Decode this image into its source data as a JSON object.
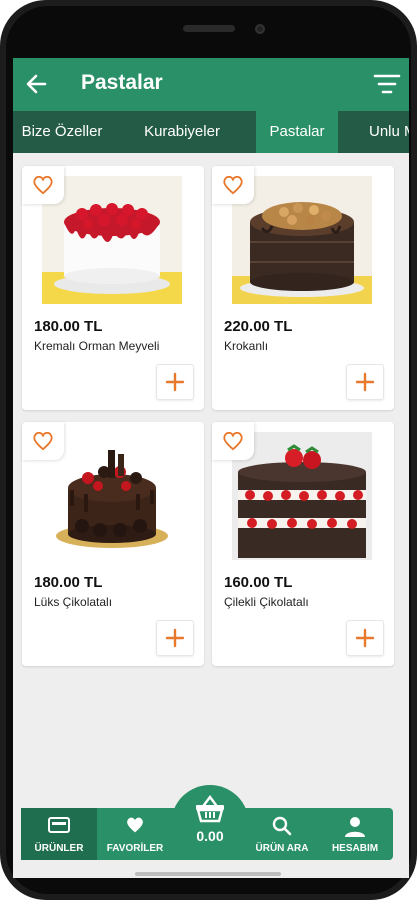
{
  "appbar": {
    "title": "Pastalar"
  },
  "tabs": [
    {
      "label": "Bize Özeller"
    },
    {
      "label": "Kurabiyeler"
    },
    {
      "label": "Pastalar"
    },
    {
      "label": "Unlu Mamuller"
    }
  ],
  "products": [
    {
      "price": "180.00 TL",
      "name": "Kremalı Orman Meyveli",
      "icon": "strawberry-cream-cake"
    },
    {
      "price": "220.00 TL",
      "name": "Krokanlı",
      "icon": "caramel-nut-cake"
    },
    {
      "price": "180.00 TL",
      "name": "Lüks Çikolatalı",
      "icon": "chocolate-cookie-cake"
    },
    {
      "price": "160.00 TL",
      "name": "Çilekli Çikolatalı",
      "icon": "strawberry-layer-cake"
    }
  ],
  "bottomnav": {
    "items": [
      {
        "label": "ÜRÜNLER",
        "icon": "products-icon"
      },
      {
        "label": "FAVORİLER",
        "icon": "heart-icon"
      },
      {
        "label": "ÜRÜN ARA",
        "icon": "search-icon"
      },
      {
        "label": "HESABIM",
        "icon": "user-icon"
      }
    ],
    "basket_amount": "0.00"
  },
  "colors": {
    "primary": "#2a9068",
    "tab_bar": "#235b46",
    "accent": "#e8782c"
  }
}
